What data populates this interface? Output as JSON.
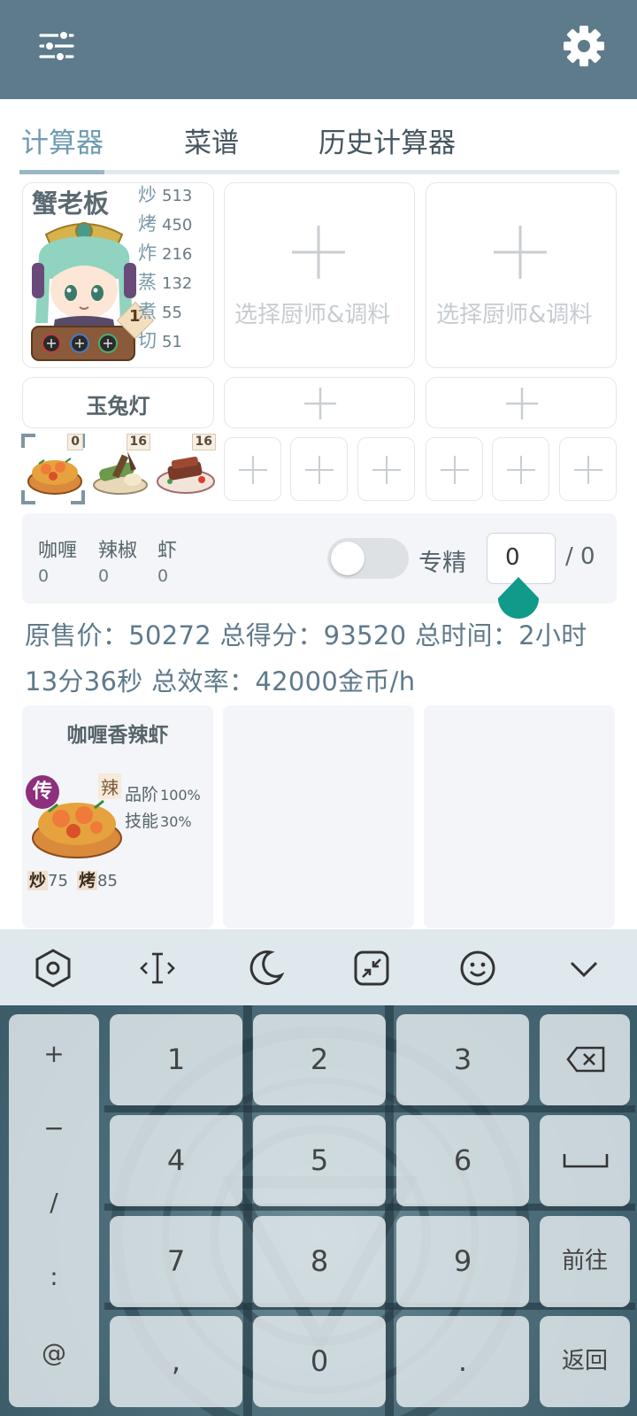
{
  "appbar": {
    "left_icon": "sliders-icon",
    "right_icon": "gear-icon"
  },
  "tabs": [
    {
      "label": "计算器",
      "active": true
    },
    {
      "label": "菜谱",
      "active": false
    },
    {
      "label": "历史计算器",
      "active": false
    }
  ],
  "chef": {
    "name": "蟹老板",
    "level_badge": "1",
    "stats": [
      {
        "key": "炒",
        "value": "513"
      },
      {
        "key": "烤",
        "value": "450"
      },
      {
        "key": "炸",
        "value": "216"
      },
      {
        "key": "蒸",
        "value": "132"
      },
      {
        "key": "煮",
        "value": "55"
      },
      {
        "key": "切",
        "value": "51"
      }
    ]
  },
  "empty_chef_label": "选择厨师&调料",
  "equipment": {
    "name": "玉兔灯"
  },
  "dish_slots": [
    {
      "badge": "0",
      "icon": "curry-shrimp-dish-icon"
    },
    {
      "badge": "16",
      "icon": "bamboo-dish-icon"
    },
    {
      "badge": "16",
      "icon": "meat-dish-icon"
    }
  ],
  "ingredients": [
    {
      "name": "咖喱",
      "value": "0"
    },
    {
      "name": "辣椒",
      "value": "0"
    },
    {
      "name": "虾",
      "value": "0"
    }
  ],
  "mastery": {
    "label": "专精",
    "value": "0",
    "max": "/ 0",
    "enabled": false
  },
  "summary": "原售价：50272 总得分：93520 总时间：2小时13分36秒 总效率：42000金币/h",
  "result": {
    "title": "咖喱香辣虾",
    "rarity": "传",
    "taste": "辣",
    "quality_label": "品阶",
    "quality_value": "100%",
    "skill_label": "技能",
    "skill_value": "30%",
    "requirements": [
      {
        "skill": "炒",
        "value": "75"
      },
      {
        "skill": "烤",
        "value": "85"
      }
    ]
  },
  "keyboard": {
    "toolbar_icons": [
      "hexagon-settings-icon",
      "cursor-move-icon",
      "moon-icon",
      "collapse-icon",
      "emoji-icon",
      "chevron-down-icon"
    ],
    "side_symbols": [
      "+",
      "−",
      "/",
      ":",
      "@"
    ],
    "digits": [
      "1",
      "2",
      "3",
      "4",
      "5",
      "6",
      "7",
      "8",
      "9",
      ",",
      "0",
      "."
    ],
    "backspace_icon": "backspace-icon",
    "space_icon": "space-icon",
    "go_label": "前往",
    "back_label": "返回"
  }
}
